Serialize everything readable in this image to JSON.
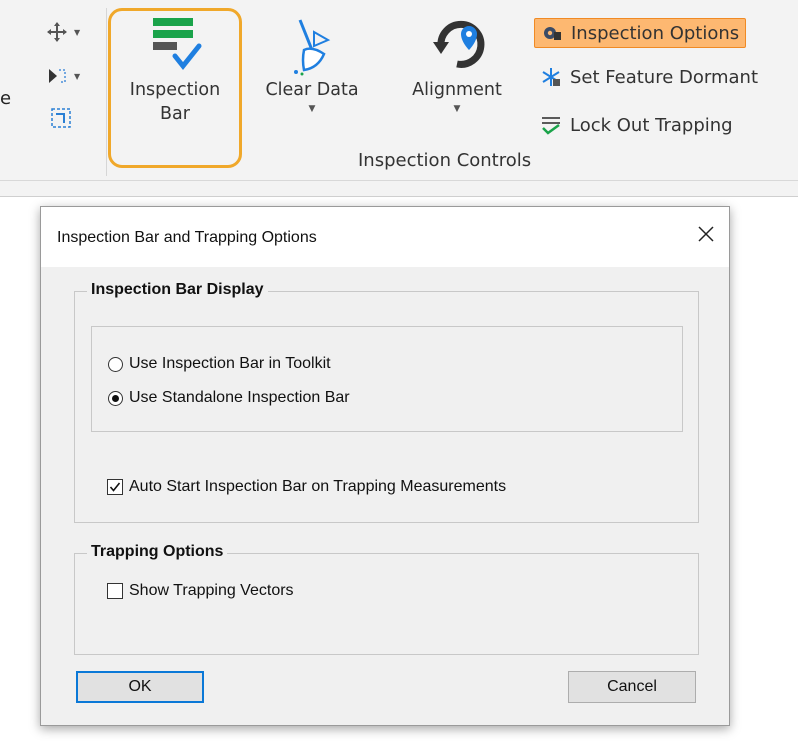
{
  "ribbon": {
    "cut_text": "e",
    "big_buttons": {
      "inspection_bar": [
        "Inspection",
        "Bar"
      ],
      "clear_data": "Clear Data",
      "alignment": "Alignment"
    },
    "side_buttons": {
      "inspection_options": "Inspection Options",
      "set_feature_dormant": "Set Feature Dormant",
      "lock_out_trapping": "Lock Out Trapping"
    },
    "group_label": "Inspection Controls",
    "highlight_color": "#f0a82a",
    "active_color": "#fdb871"
  },
  "dialog": {
    "title": "Inspection Bar and Trapping Options",
    "display_group": {
      "title": "Inspection Bar Display",
      "radio_toolkit": "Use Inspection Bar in Toolkit",
      "radio_standalone": "Use Standalone Inspection Bar",
      "selected": "Use Standalone Inspection Bar",
      "auto_start": "Auto Start Inspection Bar on Trapping Measurements",
      "auto_start_checked": true
    },
    "trapping_group": {
      "title": "Trapping Options",
      "show_vectors": "Show Trapping Vectors",
      "show_vectors_checked": false
    },
    "ok_label": "OK",
    "cancel_label": "Cancel"
  }
}
